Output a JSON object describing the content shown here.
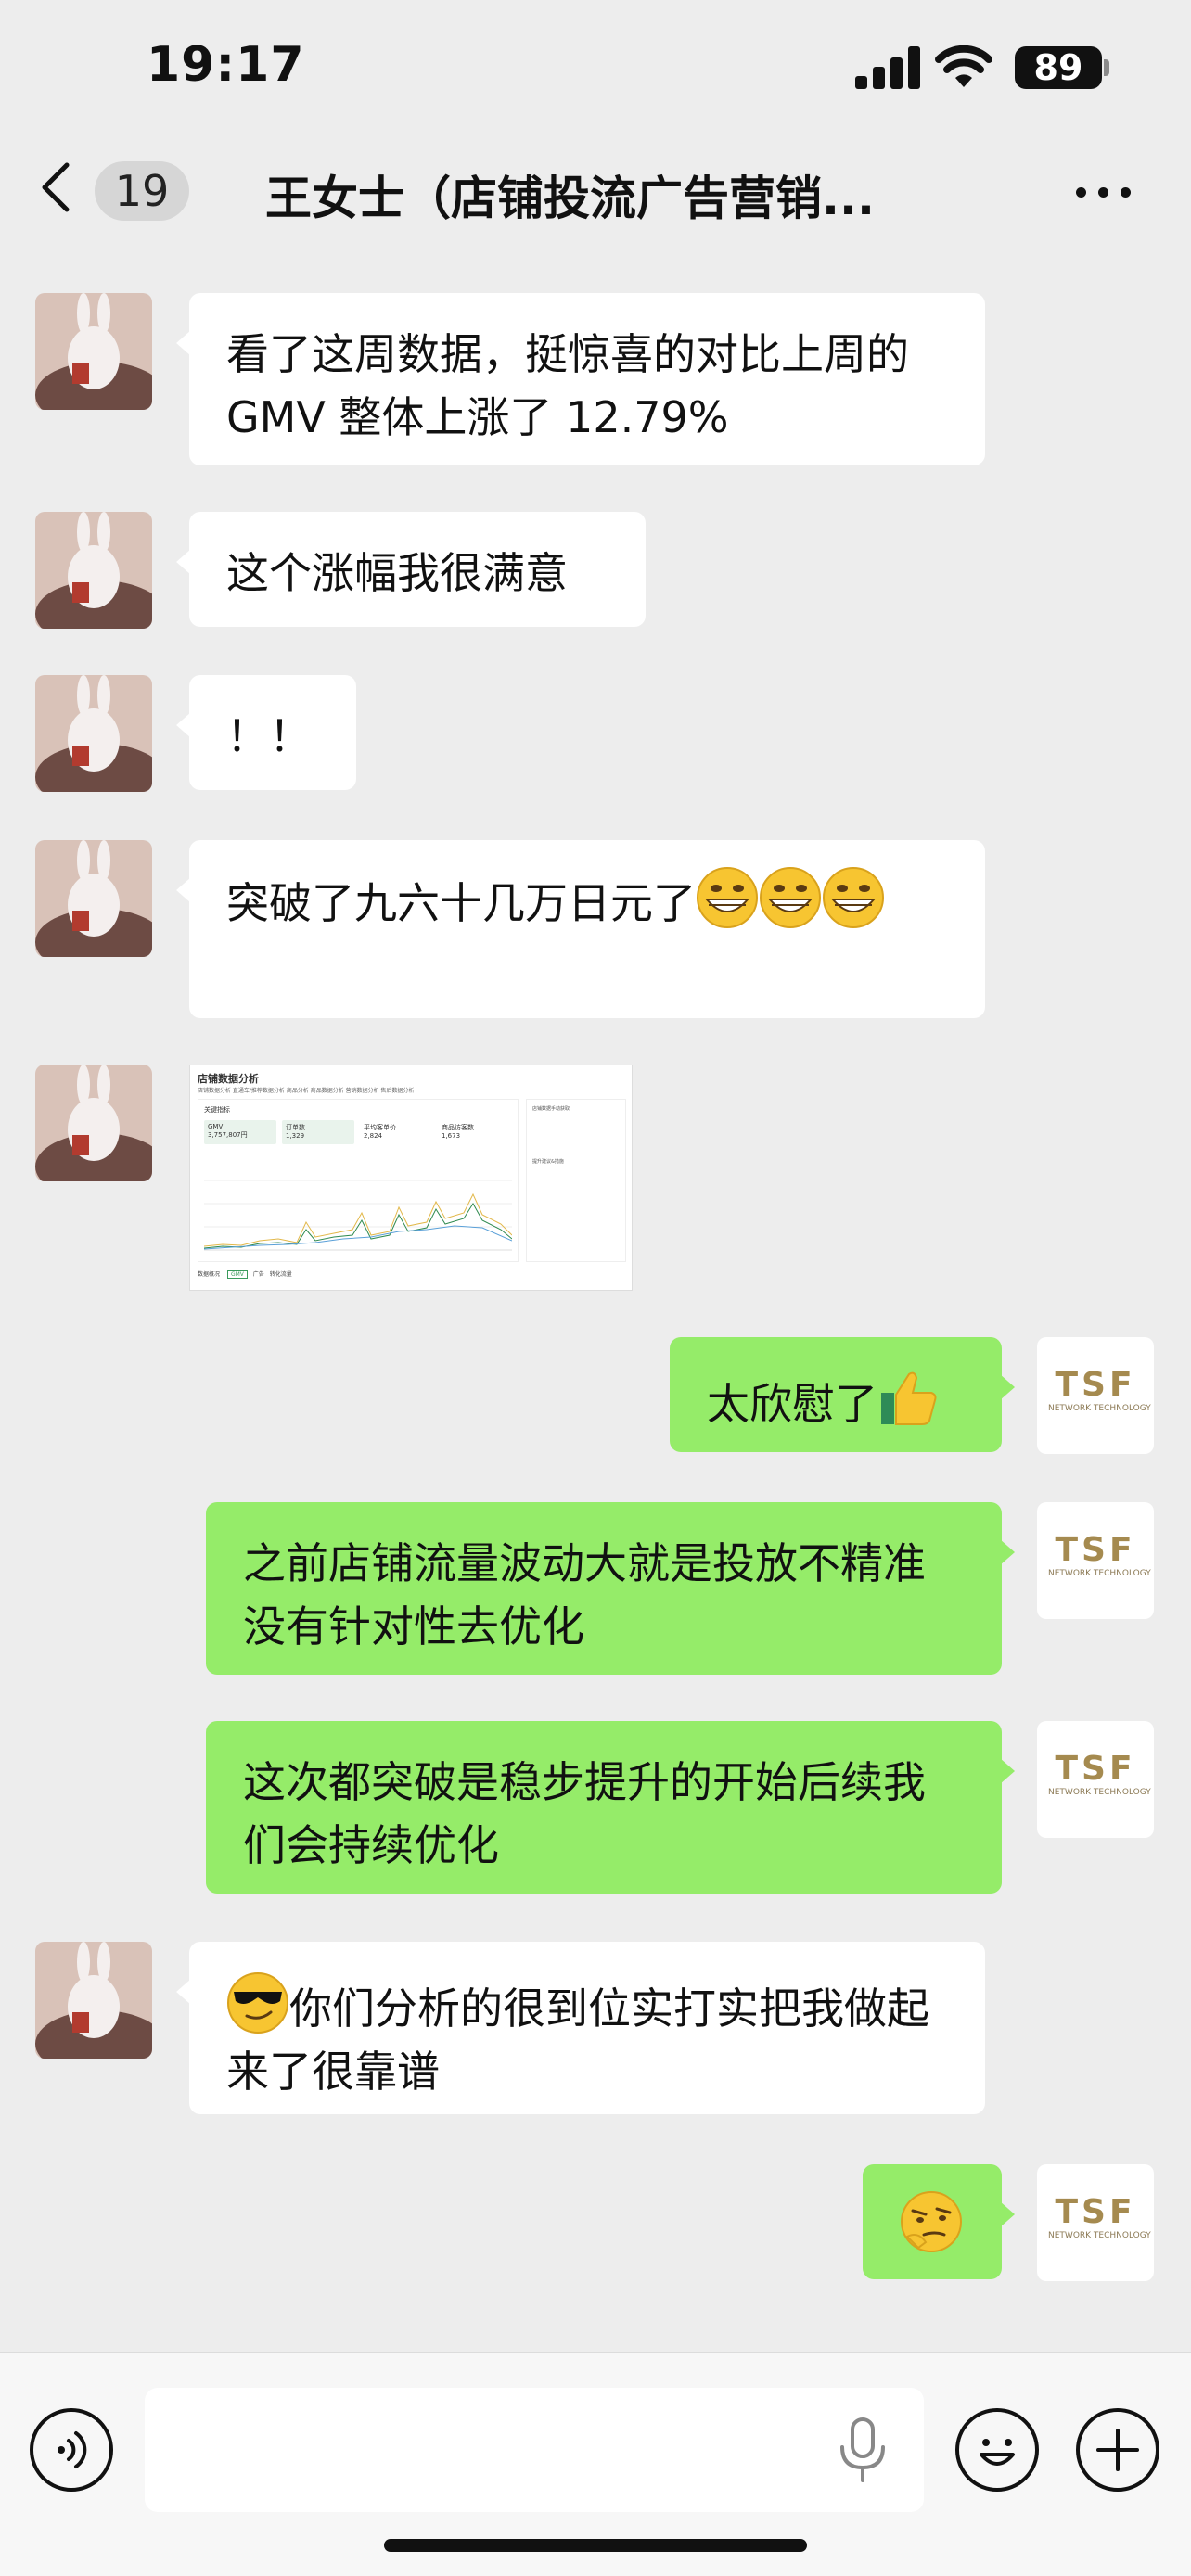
{
  "status_bar": {
    "time": "19:17",
    "battery": "89"
  },
  "nav": {
    "unread_count": "19",
    "title": "王女士（店铺投流广告营销..."
  },
  "messages": [
    {
      "side": "in",
      "type": "text",
      "text": "看了这周数据，挺惊喜的对比上周的 GMV 整体上涨了 12.79%"
    },
    {
      "side": "in",
      "type": "text",
      "text": "这个涨幅我很满意"
    },
    {
      "side": "in",
      "type": "text",
      "text": "！！"
    },
    {
      "side": "in",
      "type": "text",
      "text": "突破了九六十几万日元了",
      "emojis": [
        "grinning-face",
        "grinning-face",
        "grinning-face"
      ]
    },
    {
      "side": "in",
      "type": "image",
      "image": {
        "title": "店铺数据分析",
        "tabs": "店铺数据分析   直通车/推荐数据分析   商品分析   商品数据分析   营销数据分析   售后数据分析",
        "panel_title": "关键指标",
        "kpis": [
          {
            "label": "GMV",
            "value": "3,757,807円"
          },
          {
            "label": "订单数",
            "value": "1,329"
          },
          {
            "label": "平均客单价",
            "value": "2,824"
          },
          {
            "label": "商品访客数",
            "value": "1,673"
          }
        ],
        "side_title": "店铺数据手动获取",
        "side_sub": "提升建议&措施",
        "footer_label": "数据概况",
        "footer_tabs": [
          "GMV",
          "广告",
          "转化流量"
        ]
      }
    },
    {
      "side": "out",
      "type": "text",
      "text": "太欣慰了",
      "emojis": [
        "thumbs-up"
      ]
    },
    {
      "side": "out",
      "type": "text",
      "text": "之前店铺流量波动大就是投放不精准没有针对性去优化"
    },
    {
      "side": "out",
      "type": "text",
      "text": "这次都突破是稳步提升的开始后续我们会持续优化"
    },
    {
      "side": "in",
      "type": "text",
      "text": "你们分析的很到位实打实把我做起来了很靠谱",
      "emojis": [
        "sunglasses-face"
      ]
    },
    {
      "side": "out",
      "type": "sticker",
      "emojis": [
        "thinking-smirk-face"
      ]
    }
  ],
  "tsf_avatar": {
    "mark": "TSF",
    "sub": "NETWORK TECHNOLOGY"
  },
  "input": {
    "value": ""
  },
  "icons": {
    "back": "chevron-left-icon",
    "more": "more-dots-icon",
    "voice": "voice-icon",
    "mic": "microphone-icon",
    "emoji": "emoji-icon",
    "plus": "plus-icon"
  }
}
